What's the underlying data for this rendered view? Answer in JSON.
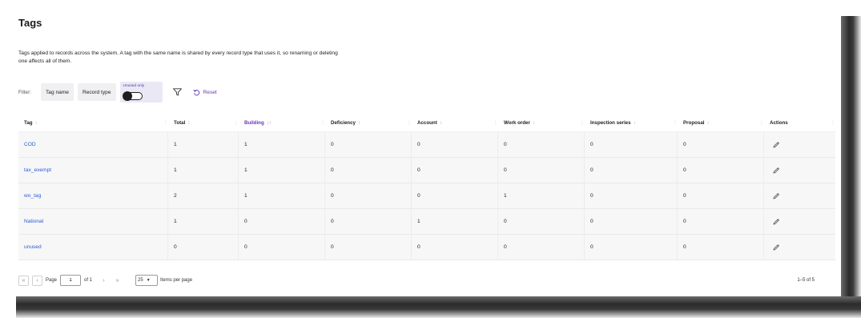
{
  "page": {
    "title": "Tags",
    "description": "Tags applied to records across the system. A tag with the same name is shared by every record type that uses it, so renaming or deleting one affects all of them."
  },
  "filters": {
    "label": "Filter:",
    "tag_name": "Tag name",
    "record_type": "Record type",
    "unused_only": "Unused only",
    "unused_only_on": false,
    "reset": "Reset"
  },
  "table": {
    "columns": [
      {
        "key": "tag",
        "label": "Tag",
        "sort": "↕"
      },
      {
        "key": "total",
        "label": "Total",
        "sort": "↕"
      },
      {
        "key": "building",
        "label": "Building",
        "sort": "↓↑",
        "active": true
      },
      {
        "key": "deficiency",
        "label": "Deficiency",
        "sort": "↕"
      },
      {
        "key": "account",
        "label": "Account",
        "sort": "↕"
      },
      {
        "key": "work_order",
        "label": "Work order",
        "sort": "↕"
      },
      {
        "key": "inspection_series",
        "label": "Inspection series",
        "sort": "↕"
      },
      {
        "key": "proposal",
        "label": "Proposal",
        "sort": "↕"
      },
      {
        "key": "actions",
        "label": "Actions",
        "sort": ""
      }
    ],
    "rows": [
      {
        "tag": "COD",
        "total": "1",
        "building": "1",
        "deficiency": "0",
        "account": "0",
        "work_order": "0",
        "inspection_series": "0",
        "proposal": "0"
      },
      {
        "tag": "tax_exempt",
        "total": "1",
        "building": "1",
        "deficiency": "0",
        "account": "0",
        "work_order": "0",
        "inspection_series": "0",
        "proposal": "0"
      },
      {
        "tag": "wo_tag",
        "total": "2",
        "building": "1",
        "deficiency": "0",
        "account": "0",
        "work_order": "1",
        "inspection_series": "0",
        "proposal": "0"
      },
      {
        "tag": "National",
        "total": "1",
        "building": "0",
        "deficiency": "0",
        "account": "1",
        "work_order": "0",
        "inspection_series": "0",
        "proposal": "0"
      },
      {
        "tag": "unused",
        "total": "0",
        "building": "0",
        "deficiency": "0",
        "account": "0",
        "work_order": "0",
        "inspection_series": "0",
        "proposal": "0"
      }
    ]
  },
  "pagination": {
    "page_label": "Page",
    "page_value": "1",
    "of_label": "of 1",
    "per_page_value": "25",
    "per_page_label": "Items per page",
    "range": "1–5 of 5"
  },
  "colors": {
    "accent": "#6a35c2",
    "link": "#2a5bd6"
  },
  "icons": {
    "filter": "filter-funnel-icon",
    "reset": "reset-icon",
    "edit": "pencil-icon"
  }
}
